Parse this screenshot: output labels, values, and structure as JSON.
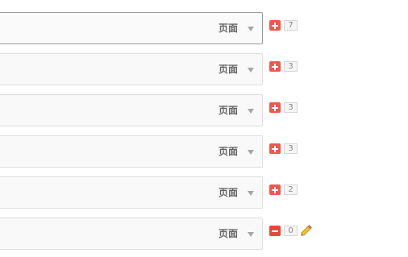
{
  "rows": [
    {
      "type_label": "页面",
      "toggle": "plus-icon",
      "count": "7",
      "active": true,
      "has_edit": false
    },
    {
      "type_label": "页面",
      "toggle": "plus-icon",
      "count": "3",
      "active": false,
      "has_edit": false
    },
    {
      "type_label": "页面",
      "toggle": "plus-icon",
      "count": "3",
      "active": false,
      "has_edit": false
    },
    {
      "type_label": "页面",
      "toggle": "plus-icon",
      "count": "3",
      "active": false,
      "has_edit": false
    },
    {
      "type_label": "页面",
      "toggle": "plus-icon",
      "count": "2",
      "active": false,
      "has_edit": false
    },
    {
      "type_label": "页面",
      "toggle": "minus-icon",
      "count": "0",
      "active": false,
      "has_edit": true
    }
  ],
  "colors": {
    "toggle_red": "#f1574c",
    "pencil_yellow": "#f2c230"
  }
}
